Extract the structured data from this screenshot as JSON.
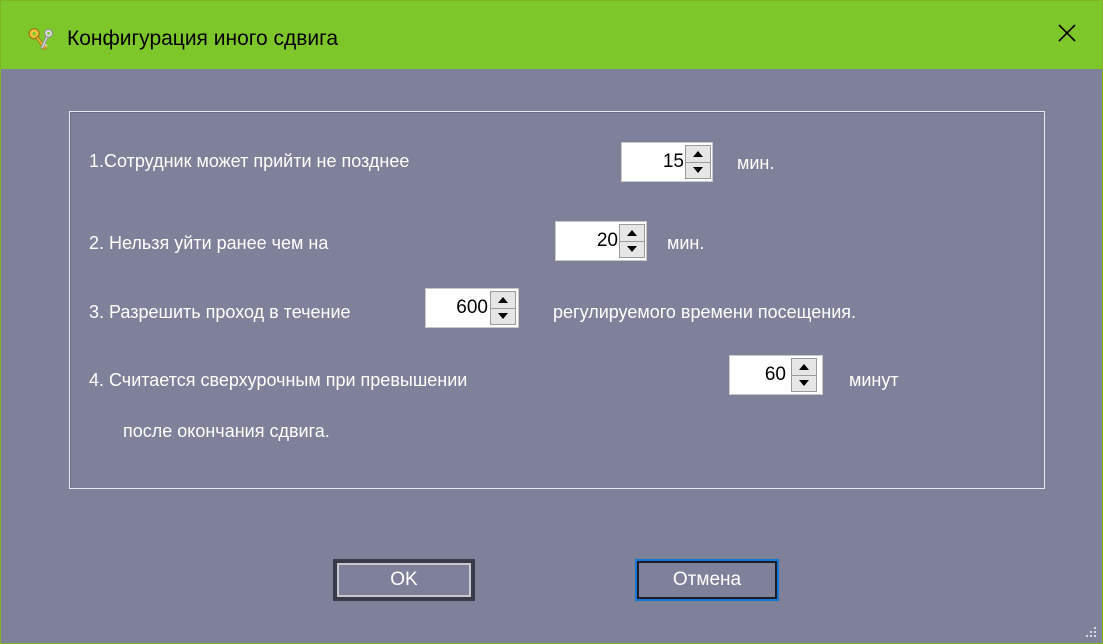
{
  "window": {
    "title": "Конфигурация иного сдвига",
    "title_icon": "keys-icon",
    "close_icon": "close-icon"
  },
  "settings": {
    "row1": {
      "label": "1.Сотрудник может прийти не позднее",
      "value": "15",
      "unit": "мин."
    },
    "row2": {
      "label": "2. Нельзя уйти ранее чем на",
      "value": "20",
      "unit": "мин."
    },
    "row3": {
      "label": "3. Разрешить проход в течение",
      "value": "600",
      "unit": "регулируемого времени посещения."
    },
    "row4": {
      "label": "4. Считается сверхурочным при превышении",
      "value": "60",
      "unit": "минут",
      "label_cont": "после окончания сдвига."
    }
  },
  "buttons": {
    "ok": "OK",
    "cancel": "Отмена"
  },
  "colors": {
    "titlebar": "#7ec72a",
    "background": "#7f8099",
    "focus_border": "#1477d6"
  }
}
